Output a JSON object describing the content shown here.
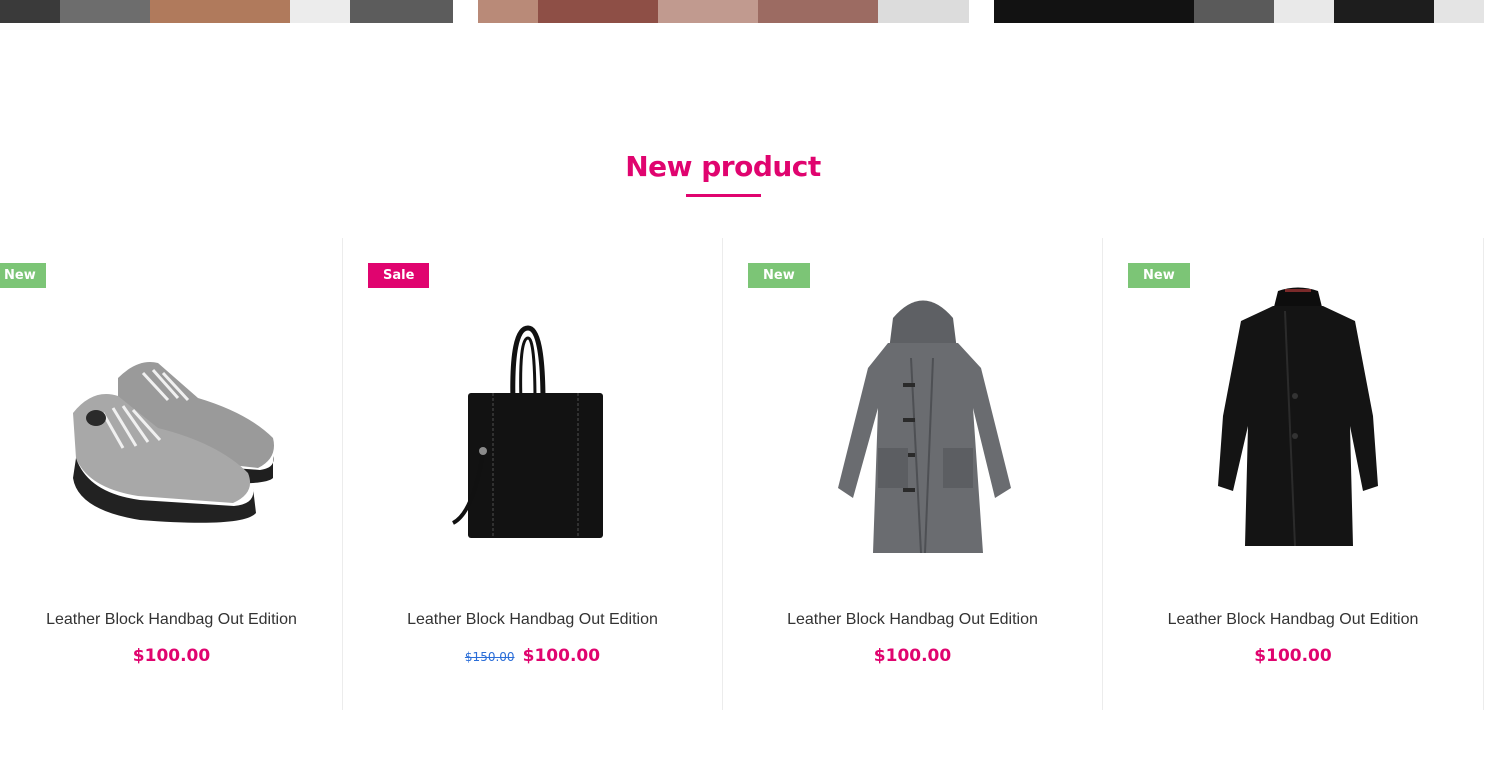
{
  "section": {
    "title": "New product"
  },
  "products": [
    {
      "badge": "New",
      "name": "Leather Block Handbag Out Edition",
      "price": "$100.00",
      "old_price": "",
      "image": "sneakers"
    },
    {
      "badge": "Sale",
      "name": "Leather Block Handbag Out Edition",
      "price": "$100.00",
      "old_price": "$150.00",
      "image": "black-tote-bag"
    },
    {
      "badge": "New",
      "name": "Leather Block Handbag Out Edition",
      "price": "$100.00",
      "old_price": "",
      "image": "grey-duffle-coat"
    },
    {
      "badge": "New",
      "name": "Leather Block Handbag Out Edition",
      "price": "$100.00",
      "old_price": "",
      "image": "black-overcoat"
    }
  ],
  "colors": {
    "accent": "#e0046f",
    "badge_new": "#7cc576",
    "old_price": "#2b6ed8"
  }
}
